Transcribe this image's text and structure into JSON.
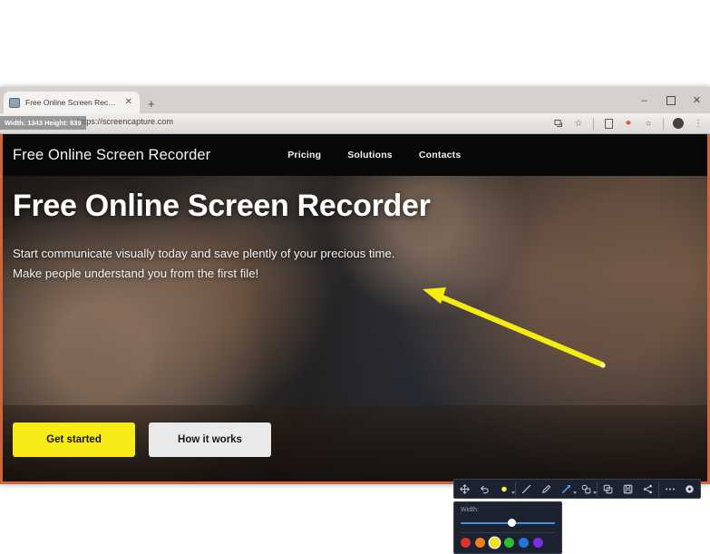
{
  "browser": {
    "tab": {
      "title": "Free Online Screen Recorder",
      "favicon_name": "monitor-icon",
      "close_label": "✕"
    },
    "new_tab_label": "+",
    "window_controls": {
      "minimize": "–",
      "maximize": "",
      "close": "✕"
    },
    "url": "https://screencapture.com",
    "size_overlay": "Width: 1343  Height: 839",
    "toolbar_icons": [
      {
        "name": "translate-icon",
        "glyph": "▤"
      },
      {
        "name": "bookmark-star-icon",
        "glyph": "☆"
      },
      {
        "name": "extension-icon",
        "glyph": ""
      },
      {
        "name": "screen-recorder-extension-icon",
        "glyph": "⚭"
      },
      {
        "name": "profile-circle-icon",
        "glyph": "○"
      },
      {
        "name": "avatar-icon",
        "glyph": ""
      },
      {
        "name": "browser-menu-icon",
        "glyph": "⋮"
      }
    ]
  },
  "site": {
    "logo": "Free Online Screen Recorder",
    "nav": [
      {
        "label": "Pricing"
      },
      {
        "label": "Solutions"
      },
      {
        "label": "Contacts"
      }
    ],
    "hero": {
      "heading": "Free Online Screen Recorder",
      "line1": "Start communicate visually today and save plently of your precious time.",
      "line2": "Make people understand you from the first file!",
      "primary_button": "Get started",
      "secondary_button": "How it works"
    },
    "colors": {
      "header_bg": "#080808",
      "primary_button_bg": "#f7ea16",
      "secondary_button_bg": "#e9e9e9",
      "annotation_arrow": "#f5ec13",
      "recording_border": "#d2643c"
    }
  },
  "annotation_toolbar": {
    "groups": [
      {
        "items": [
          {
            "name": "move-icon",
            "label": "Move"
          },
          {
            "name": "undo-icon",
            "label": "Undo"
          },
          {
            "name": "highlighter-icon",
            "label": "Highlighter",
            "has_caret": true
          }
        ]
      },
      {
        "items": [
          {
            "name": "line-icon",
            "label": "Line"
          },
          {
            "name": "pen-icon",
            "label": "Pen"
          },
          {
            "name": "arrow-icon",
            "label": "Arrow",
            "active": true,
            "has_caret": true
          },
          {
            "name": "shapes-icon",
            "label": "Shapes",
            "has_caret": true
          }
        ]
      },
      {
        "items": [
          {
            "name": "copy-icon",
            "label": "Copy"
          },
          {
            "name": "save-icon",
            "label": "Save"
          },
          {
            "name": "share-icon",
            "label": "Share"
          }
        ]
      },
      {
        "items": [
          {
            "name": "more-options-icon",
            "label": "More"
          },
          {
            "name": "close-icon",
            "label": "Close"
          }
        ]
      }
    ]
  },
  "width_panel": {
    "label": "Width:",
    "slider_value": 55,
    "swatches": [
      {
        "name": "color-red",
        "hex": "#d9372b",
        "selected": false
      },
      {
        "name": "color-orange",
        "hex": "#ef7d1a",
        "selected": false
      },
      {
        "name": "color-yellow",
        "hex": "#f2e216",
        "selected": true
      },
      {
        "name": "color-green",
        "hex": "#2fbf33",
        "selected": false
      },
      {
        "name": "color-blue",
        "hex": "#2b6fe0",
        "selected": false
      },
      {
        "name": "color-purple",
        "hex": "#7a2fe0",
        "selected": false
      }
    ]
  }
}
